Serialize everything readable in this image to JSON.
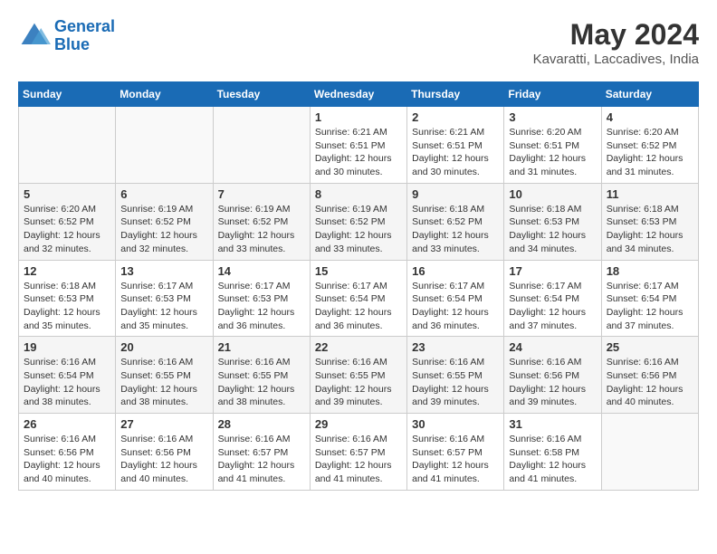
{
  "logo": {
    "line1": "General",
    "line2": "Blue"
  },
  "title": "May 2024",
  "subtitle": "Kavaratti, Laccadives, India",
  "days_header": [
    "Sunday",
    "Monday",
    "Tuesday",
    "Wednesday",
    "Thursday",
    "Friday",
    "Saturday"
  ],
  "weeks": [
    [
      {
        "num": "",
        "info": ""
      },
      {
        "num": "",
        "info": ""
      },
      {
        "num": "",
        "info": ""
      },
      {
        "num": "1",
        "info": "Sunrise: 6:21 AM\nSunset: 6:51 PM\nDaylight: 12 hours\nand 30 minutes."
      },
      {
        "num": "2",
        "info": "Sunrise: 6:21 AM\nSunset: 6:51 PM\nDaylight: 12 hours\nand 30 minutes."
      },
      {
        "num": "3",
        "info": "Sunrise: 6:20 AM\nSunset: 6:51 PM\nDaylight: 12 hours\nand 31 minutes."
      },
      {
        "num": "4",
        "info": "Sunrise: 6:20 AM\nSunset: 6:52 PM\nDaylight: 12 hours\nand 31 minutes."
      }
    ],
    [
      {
        "num": "5",
        "info": "Sunrise: 6:20 AM\nSunset: 6:52 PM\nDaylight: 12 hours\nand 32 minutes."
      },
      {
        "num": "6",
        "info": "Sunrise: 6:19 AM\nSunset: 6:52 PM\nDaylight: 12 hours\nand 32 minutes."
      },
      {
        "num": "7",
        "info": "Sunrise: 6:19 AM\nSunset: 6:52 PM\nDaylight: 12 hours\nand 33 minutes."
      },
      {
        "num": "8",
        "info": "Sunrise: 6:19 AM\nSunset: 6:52 PM\nDaylight: 12 hours\nand 33 minutes."
      },
      {
        "num": "9",
        "info": "Sunrise: 6:18 AM\nSunset: 6:52 PM\nDaylight: 12 hours\nand 33 minutes."
      },
      {
        "num": "10",
        "info": "Sunrise: 6:18 AM\nSunset: 6:53 PM\nDaylight: 12 hours\nand 34 minutes."
      },
      {
        "num": "11",
        "info": "Sunrise: 6:18 AM\nSunset: 6:53 PM\nDaylight: 12 hours\nand 34 minutes."
      }
    ],
    [
      {
        "num": "12",
        "info": "Sunrise: 6:18 AM\nSunset: 6:53 PM\nDaylight: 12 hours\nand 35 minutes."
      },
      {
        "num": "13",
        "info": "Sunrise: 6:17 AM\nSunset: 6:53 PM\nDaylight: 12 hours\nand 35 minutes."
      },
      {
        "num": "14",
        "info": "Sunrise: 6:17 AM\nSunset: 6:53 PM\nDaylight: 12 hours\nand 36 minutes."
      },
      {
        "num": "15",
        "info": "Sunrise: 6:17 AM\nSunset: 6:54 PM\nDaylight: 12 hours\nand 36 minutes."
      },
      {
        "num": "16",
        "info": "Sunrise: 6:17 AM\nSunset: 6:54 PM\nDaylight: 12 hours\nand 36 minutes."
      },
      {
        "num": "17",
        "info": "Sunrise: 6:17 AM\nSunset: 6:54 PM\nDaylight: 12 hours\nand 37 minutes."
      },
      {
        "num": "18",
        "info": "Sunrise: 6:17 AM\nSunset: 6:54 PM\nDaylight: 12 hours\nand 37 minutes."
      }
    ],
    [
      {
        "num": "19",
        "info": "Sunrise: 6:16 AM\nSunset: 6:54 PM\nDaylight: 12 hours\nand 38 minutes."
      },
      {
        "num": "20",
        "info": "Sunrise: 6:16 AM\nSunset: 6:55 PM\nDaylight: 12 hours\nand 38 minutes."
      },
      {
        "num": "21",
        "info": "Sunrise: 6:16 AM\nSunset: 6:55 PM\nDaylight: 12 hours\nand 38 minutes."
      },
      {
        "num": "22",
        "info": "Sunrise: 6:16 AM\nSunset: 6:55 PM\nDaylight: 12 hours\nand 39 minutes."
      },
      {
        "num": "23",
        "info": "Sunrise: 6:16 AM\nSunset: 6:55 PM\nDaylight: 12 hours\nand 39 minutes."
      },
      {
        "num": "24",
        "info": "Sunrise: 6:16 AM\nSunset: 6:56 PM\nDaylight: 12 hours\nand 39 minutes."
      },
      {
        "num": "25",
        "info": "Sunrise: 6:16 AM\nSunset: 6:56 PM\nDaylight: 12 hours\nand 40 minutes."
      }
    ],
    [
      {
        "num": "26",
        "info": "Sunrise: 6:16 AM\nSunset: 6:56 PM\nDaylight: 12 hours\nand 40 minutes."
      },
      {
        "num": "27",
        "info": "Sunrise: 6:16 AM\nSunset: 6:56 PM\nDaylight: 12 hours\nand 40 minutes."
      },
      {
        "num": "28",
        "info": "Sunrise: 6:16 AM\nSunset: 6:57 PM\nDaylight: 12 hours\nand 41 minutes."
      },
      {
        "num": "29",
        "info": "Sunrise: 6:16 AM\nSunset: 6:57 PM\nDaylight: 12 hours\nand 41 minutes."
      },
      {
        "num": "30",
        "info": "Sunrise: 6:16 AM\nSunset: 6:57 PM\nDaylight: 12 hours\nand 41 minutes."
      },
      {
        "num": "31",
        "info": "Sunrise: 6:16 AM\nSunset: 6:58 PM\nDaylight: 12 hours\nand 41 minutes."
      },
      {
        "num": "",
        "info": ""
      }
    ]
  ]
}
